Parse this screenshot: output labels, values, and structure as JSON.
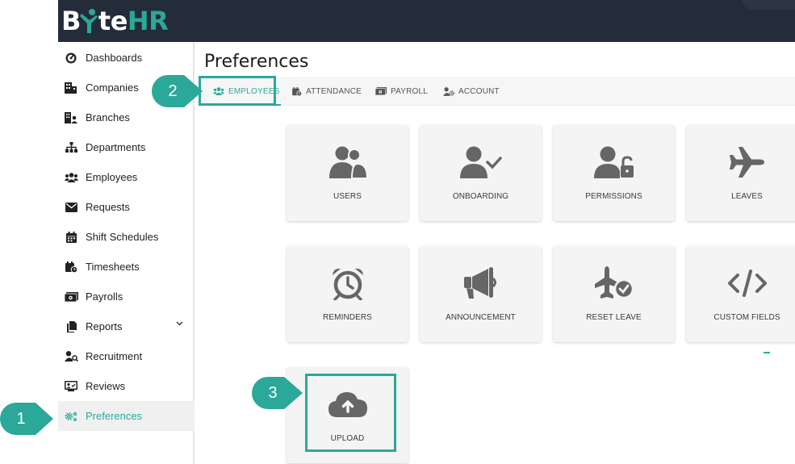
{
  "app": {
    "logo_parts": [
      "B",
      "te",
      "HR"
    ]
  },
  "sidebar": {
    "items": [
      {
        "label": "Dashboards",
        "icon": "dashboard-gauge-icon"
      },
      {
        "label": "Companies",
        "icon": "building-icon"
      },
      {
        "label": "Branches",
        "icon": "branches-icon"
      },
      {
        "label": "Departments",
        "icon": "sitemap-icon"
      },
      {
        "label": "Employees",
        "icon": "users-icon"
      },
      {
        "label": "Requests",
        "icon": "envelope-icon"
      },
      {
        "label": "Shift Schedules",
        "icon": "calendar-icon"
      },
      {
        "label": "Timesheets",
        "icon": "calendar-clock-icon"
      },
      {
        "label": "Payrolls",
        "icon": "money-bill-icon"
      },
      {
        "label": "Reports",
        "icon": "file-icon",
        "has_chevron": true
      },
      {
        "label": "Recruitment",
        "icon": "user-search-icon"
      },
      {
        "label": "Reviews",
        "icon": "review-icon"
      },
      {
        "label": "Preferences",
        "icon": "gears-icon",
        "active": true
      }
    ]
  },
  "main": {
    "title": "Preferences",
    "tabs": [
      {
        "label": "EMPLOYEES",
        "icon": "users-icon",
        "active": true
      },
      {
        "label": "ATTENDANCE",
        "icon": "calendar-clock-icon"
      },
      {
        "label": "PAYROLL",
        "icon": "money-bill-icon"
      },
      {
        "label": "ACCOUNT",
        "icon": "user-cog-icon"
      }
    ],
    "cards": [
      {
        "label": "USERS",
        "icon": "users-icon"
      },
      {
        "label": "ONBOARDING",
        "icon": "user-check-icon"
      },
      {
        "label": "PERMISSIONS",
        "icon": "user-lock-icon"
      },
      {
        "label": "LEAVES",
        "icon": "plane-icon"
      },
      {
        "label": "REMINDERS",
        "icon": "alarm-clock-icon"
      },
      {
        "label": "ANNOUNCEMENT",
        "icon": "megaphone-icon"
      },
      {
        "label": "RESET LEAVE",
        "icon": "plane-check-icon"
      },
      {
        "label": "CUSTOM FIELDS",
        "icon": "code-icon"
      },
      {
        "label": "UPLOAD",
        "icon": "cloud-upload-icon"
      }
    ]
  },
  "callouts": [
    {
      "number": "1",
      "target": "Preferences"
    },
    {
      "number": "2",
      "target": "EMPLOYEES"
    },
    {
      "number": "3",
      "target": "UPLOAD"
    }
  ],
  "colors": {
    "accent": "#2ba89a",
    "topbar": "#242c3a",
    "icon_gray": "#666666"
  }
}
